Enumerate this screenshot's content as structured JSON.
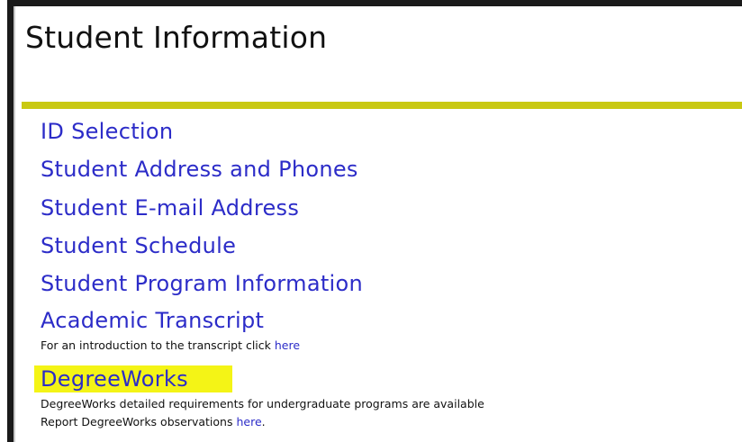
{
  "page": {
    "title": "Student Information"
  },
  "menu": {
    "items": [
      {
        "label": "ID Selection"
      },
      {
        "label": "Student Address and Phones"
      },
      {
        "label": "Student E-mail Address"
      },
      {
        "label": "Student Schedule"
      },
      {
        "label": "Student Program Information"
      },
      {
        "label": "Academic Transcript"
      }
    ],
    "transcript_note": {
      "text": "For an introduction to the transcript click ",
      "link": "here"
    },
    "degreeworks": {
      "label": "DegreeWorks",
      "line1": "DegreeWorks detailed requirements for undergraduate programs are available",
      "line2_text": "Report DegreeWorks observations ",
      "line2_link": "here",
      "line2_suffix": "."
    }
  },
  "colors": {
    "link": "#2c2cc8",
    "rule": "#c9c912",
    "highlight": "#f4f416"
  }
}
